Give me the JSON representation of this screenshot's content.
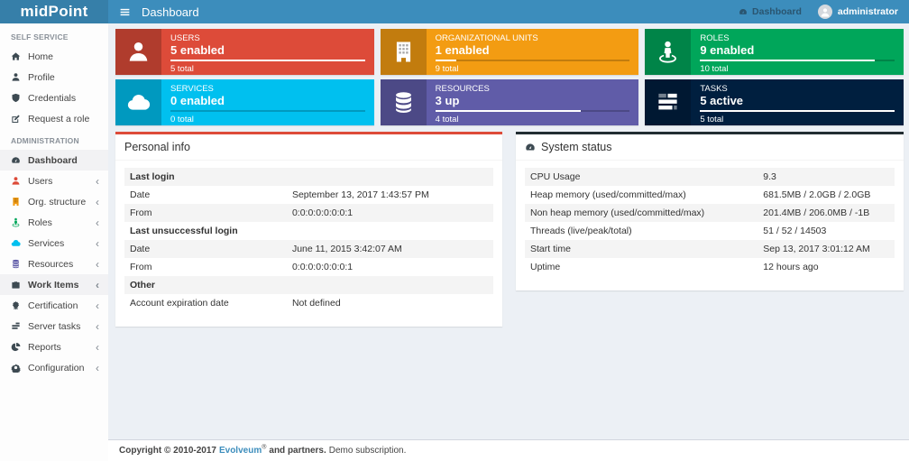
{
  "navbar": {
    "logo": "midPoint",
    "page_title": "Dashboard",
    "breadcrumb": {
      "icon": "tachometer-icon",
      "label": "Dashboard"
    },
    "user": {
      "icon": "user-icon",
      "name": "administrator"
    }
  },
  "colors": {
    "navbar_blue": "#3c8dbc",
    "red": "#dd4b39",
    "orange": "#f39c12",
    "green": "#00a65a",
    "aqua": "#00c0ef",
    "purple": "#605ca8",
    "navy": "#001f3f",
    "dark": "#222d32",
    "page_bg": "#ecf0f5"
  },
  "sidebar": {
    "sections": [
      {
        "label": "SELF SERVICE",
        "items": [
          {
            "icon": "home-icon",
            "label": "Home"
          },
          {
            "icon": "user-icon",
            "label": "Profile"
          },
          {
            "icon": "shield-icon",
            "label": "Credentials"
          },
          {
            "icon": "edit-icon",
            "label": "Request a role"
          }
        ]
      },
      {
        "label": "ADMINISTRATION",
        "items": [
          {
            "icon": "dashboard-icon",
            "label": "Dashboard",
            "active": true
          },
          {
            "icon": "users-icon",
            "label": "Users",
            "icon_color": "#dd4b39",
            "chevron": true
          },
          {
            "icon": "building-icon",
            "label": "Org. structure",
            "icon_color": "#f39c12",
            "chevron": true
          },
          {
            "icon": "street-view-icon",
            "label": "Roles",
            "icon_color": "#00a65a",
            "chevron": true
          },
          {
            "icon": "cloud-icon",
            "label": "Services",
            "icon_color": "#00c0ef",
            "chevron": true
          },
          {
            "icon": "database-icon",
            "label": "Resources",
            "icon_color": "#605ca8",
            "chevron": true
          },
          {
            "icon": "briefcase-icon",
            "label": "Work Items",
            "active": true,
            "chevron": true
          },
          {
            "icon": "certificate-icon",
            "label": "Certification",
            "chevron": true
          },
          {
            "icon": "tasks-icon",
            "label": "Server tasks",
            "chevron": true
          },
          {
            "icon": "pie-chart-icon",
            "label": "Reports",
            "chevron": true
          },
          {
            "icon": "gear-icon",
            "label": "Configuration",
            "chevron": true
          }
        ]
      }
    ]
  },
  "infoboxes": [
    {
      "label": "USERS",
      "value": "5 enabled",
      "total": "5 total",
      "icon": "users-icon",
      "color": "#dd4b39",
      "progress": "100%"
    },
    {
      "label": "ORGANIZATIONAL UNITS",
      "value": "1 enabled",
      "total": "9 total",
      "icon": "building-icon",
      "color": "#f39c12",
      "progress": "11%"
    },
    {
      "label": "ROLES",
      "value": "9 enabled",
      "total": "10 total",
      "icon": "street-view-icon",
      "color": "#00a65a",
      "progress": "90%"
    },
    {
      "label": "SERVICES",
      "value": "0 enabled",
      "total": "0 total",
      "icon": "cloud-icon",
      "color": "#00c0ef",
      "progress": "0%"
    },
    {
      "label": "RESOURCES",
      "value": "3 up",
      "total": "4 total",
      "icon": "database-icon",
      "color": "#605ca8",
      "progress": "75%"
    },
    {
      "label": "TASKS",
      "value": "5 active",
      "total": "5 total",
      "icon": "tasks-icon",
      "color": "#001f3f",
      "progress": "100%"
    }
  ],
  "personal_info": {
    "title": "Personal info",
    "accent": "#dd4b39",
    "rows": [
      {
        "type": "section",
        "label": "Last login"
      },
      {
        "type": "kv",
        "label": "Date",
        "value": "September 13, 2017 1:43:57 PM"
      },
      {
        "type": "kv",
        "label": "From",
        "value": "0:0:0:0:0:0:0:1"
      },
      {
        "type": "section",
        "label": "Last unsuccessful login"
      },
      {
        "type": "kv",
        "label": "Date",
        "value": "June 11, 2015 3:42:07 AM"
      },
      {
        "type": "kv",
        "label": "From",
        "value": "0:0:0:0:0:0:0:1"
      },
      {
        "type": "section",
        "label": "Other"
      },
      {
        "type": "kv",
        "label": "Account expiration date",
        "value": "Not defined"
      }
    ]
  },
  "system_status": {
    "title": "System status",
    "icon": "tachometer-icon",
    "accent": "#222d32",
    "rows": [
      {
        "label": "CPU Usage",
        "value": "9.3"
      },
      {
        "label": "Heap memory (used/committed/max)",
        "value": "681.5MB / 2.0GB / 2.0GB"
      },
      {
        "label": "Non heap memory (used/committed/max)",
        "value": "201.4MB / 206.0MB / -1B"
      },
      {
        "label": "Threads (live/peak/total)",
        "value": "51 / 52 / 14503"
      },
      {
        "label": "Start time",
        "value": "Sep 13, 2017 3:01:12 AM"
      },
      {
        "label": "Uptime",
        "value": "12 hours ago"
      }
    ]
  },
  "footer": {
    "prefix": "Copyright © 2010-2017",
    "link": "Evolveum",
    "reg": "®",
    "suffix": "and partners.",
    "demo": "Demo subscription."
  }
}
